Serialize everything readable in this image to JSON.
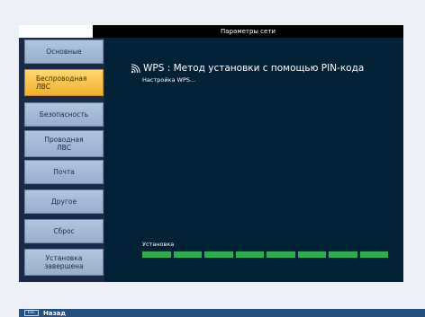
{
  "window": {
    "title": "Параметры сети"
  },
  "sidebar": {
    "items": [
      {
        "lines": [
          "Основные"
        ],
        "active": false
      },
      {
        "lines": [
          "Беспроводная",
          "ЛВС"
        ],
        "active": true
      },
      {
        "lines": [
          "Безопасность"
        ],
        "active": false
      },
      {
        "lines": [
          "Проводная",
          "ЛВС"
        ],
        "active": false
      },
      {
        "lines": [
          "Почта"
        ],
        "active": false
      },
      {
        "lines": [
          "Другое"
        ],
        "active": false
      },
      {
        "lines": [
          "Сброс"
        ],
        "active": false
      },
      {
        "lines": [
          "Установка",
          "завершена"
        ],
        "active": true
      }
    ]
  },
  "main": {
    "heading": "WPS : Метод установки с помощью PIN-кода",
    "heading_icon": "wifi-icon",
    "status_text": "Настройка WPS...",
    "progress_label": "Установка",
    "progress_segments": 8,
    "progress_filled": 8
  },
  "footer": {
    "key_label": "ESC",
    "back_label": "Назад"
  },
  "colors": {
    "panel_bg": "#012136",
    "active_item": "#f0b22e",
    "progress": "#2cb04f",
    "footer_bg": "#23507e"
  }
}
